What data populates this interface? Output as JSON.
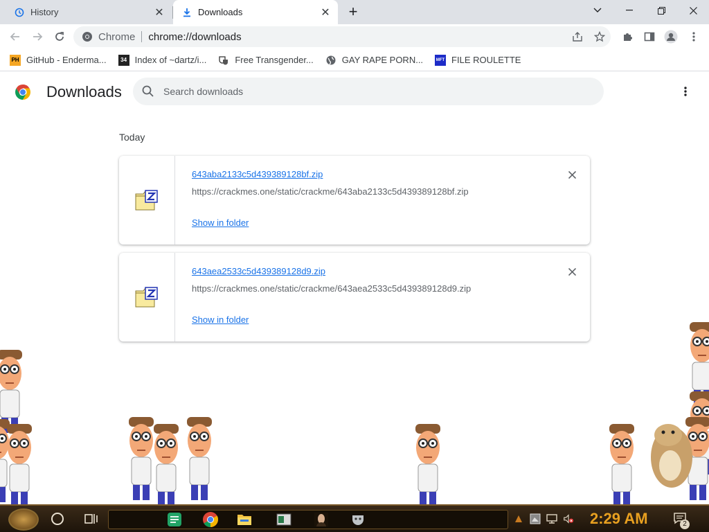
{
  "browser": {
    "tabs": [
      {
        "label": "History",
        "icon": "history-icon",
        "active": false
      },
      {
        "label": "Downloads",
        "icon": "download-icon",
        "active": true
      }
    ],
    "omnibox": {
      "scheme_label": "Chrome",
      "url": "chrome://downloads"
    },
    "bookmarks": [
      {
        "label": "GitHub - Enderma...",
        "icon": "ph-favicon"
      },
      {
        "label": "Index of ~dartz/i...",
        "icon": "index-favicon"
      },
      {
        "label": "Free Transgender...",
        "icon": "theater-favicon"
      },
      {
        "label": "GAY RAPE PORN...",
        "icon": "globe-icon"
      },
      {
        "label": "FILE ROULETTE",
        "icon": "mft-favicon"
      }
    ]
  },
  "page": {
    "title": "Downloads",
    "search_placeholder": "Search downloads",
    "section": "Today",
    "items": [
      {
        "filename": "643aba2133c5d439389128bf.zip",
        "url": "https://crackmes.one/static/crackme/643aba2133c5d439389128bf.zip",
        "action": "Show in folder"
      },
      {
        "filename": "643aea2533c5d439389128d9.zip",
        "url": "https://crackmes.one/static/crackme/643aea2533c5d439389128d9.zip",
        "action": "Show in folder"
      }
    ]
  },
  "taskbar": {
    "clock": "2:29 AM",
    "notification_count": "2",
    "apps": [
      "spreadsheet-app-icon",
      "chrome-icon",
      "file-explorer-icon",
      "window-app-icon",
      "portrait-app-icon",
      "mask-app-icon"
    ]
  },
  "colors": {
    "accent": "#1a73e8",
    "tabstrip": "#dee1e6",
    "clock": "#e8a020"
  }
}
